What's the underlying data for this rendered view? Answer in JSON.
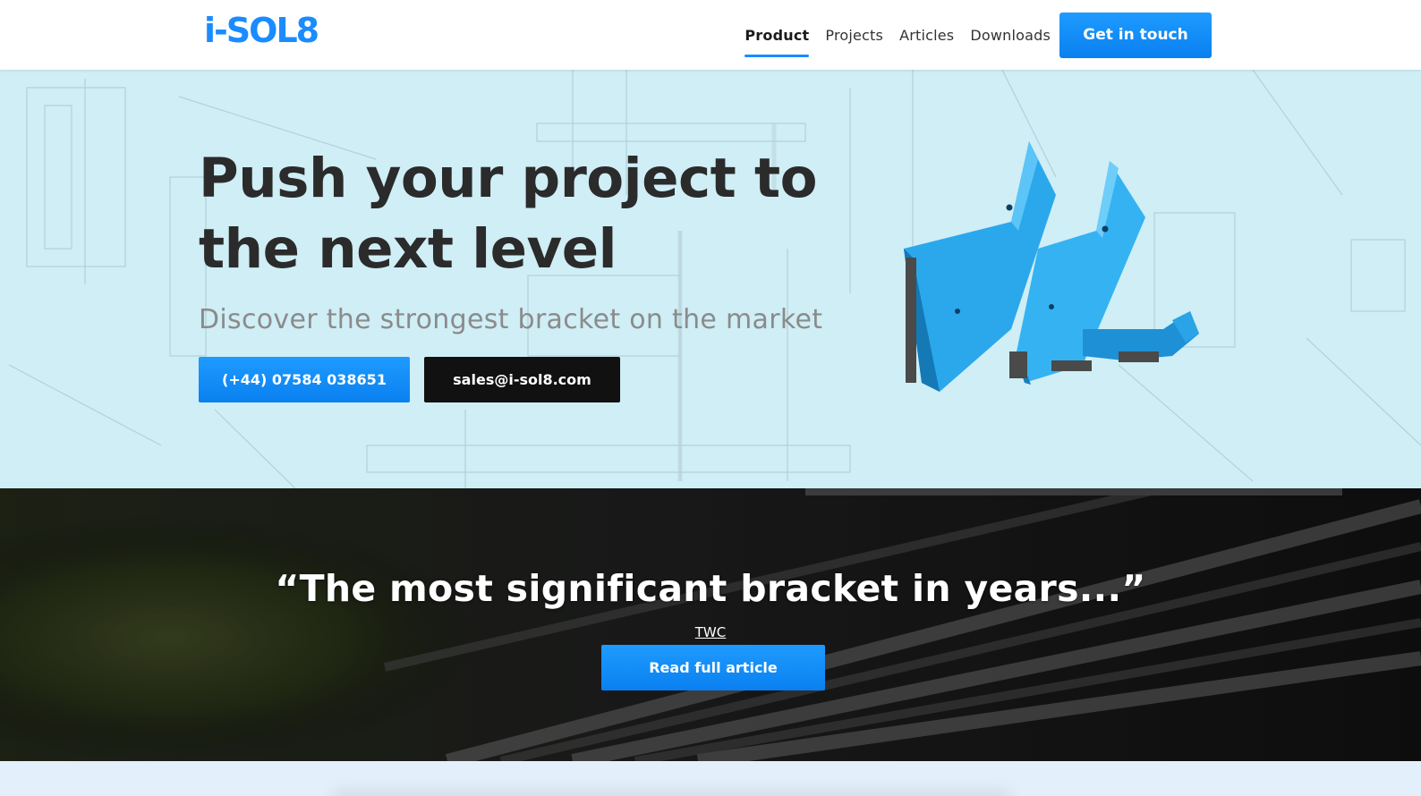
{
  "header": {
    "logo_text": "i-SOL8",
    "nav": [
      {
        "label": "Product",
        "active": true
      },
      {
        "label": "Projects",
        "active": false
      },
      {
        "label": "Articles",
        "active": false
      },
      {
        "label": "Downloads",
        "active": false
      }
    ],
    "cta_label": "Get in touch"
  },
  "hero": {
    "title": "Push your project to the next level",
    "subtitle": "Discover the strongest bracket on the market",
    "phone_button": "(+44) 07584 038651",
    "email_button": "sales@i-sol8.com"
  },
  "quote": {
    "text": "“The most significant bracket in years...”",
    "source": "TWC",
    "button": "Read full article"
  },
  "colors": {
    "accent": "#1a8cff",
    "hero_bg": "#cfeef5",
    "dark_button": "#111111",
    "bottom_strip": "#e3f0fb"
  }
}
